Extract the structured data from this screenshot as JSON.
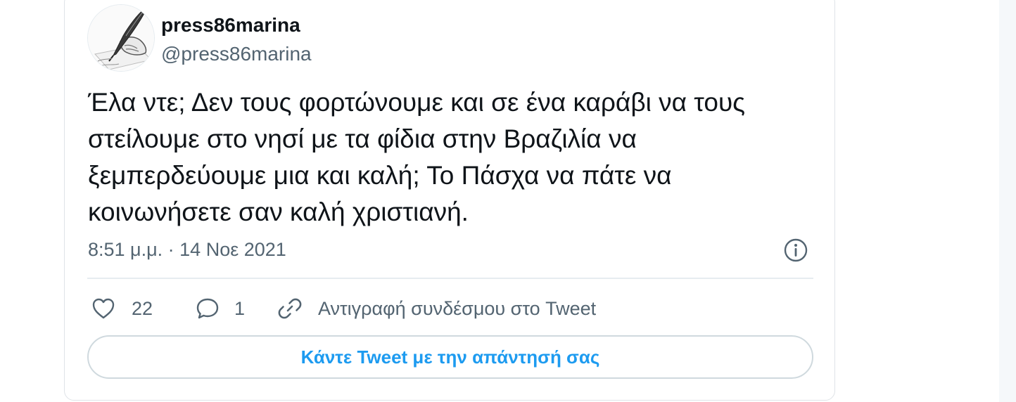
{
  "author": {
    "display_name": "press86marina",
    "handle": "@press86marina",
    "avatar_icon": "quill-pen-writing-icon"
  },
  "tweet": {
    "lines": [
      "Έλα ντε; Δεν τους φορτώνουμε και σε ένα καράβι να τους",
      "στείλουμε στο νησί με τα φίδια στην Βραζιλία να",
      "ξεμπερδεύουμε μια και καλή; Το Πάσχα να πάτε να",
      "κοινωνήσετε σαν καλή χριστιανή."
    ],
    "timestamp": "8:51 μ.μ. · 14 Νοε 2021"
  },
  "actions": {
    "like_count": "22",
    "reply_count": "1",
    "copy_link_label": "Αντιγραφή συνδέσμου στο Tweet"
  },
  "reply_button_label": "Κάντε Tweet με την απάντησή σας",
  "colors": {
    "accent": "#1d9bf0",
    "text": "#0f1419",
    "secondary": "#536471",
    "border": "#cfd9de"
  }
}
